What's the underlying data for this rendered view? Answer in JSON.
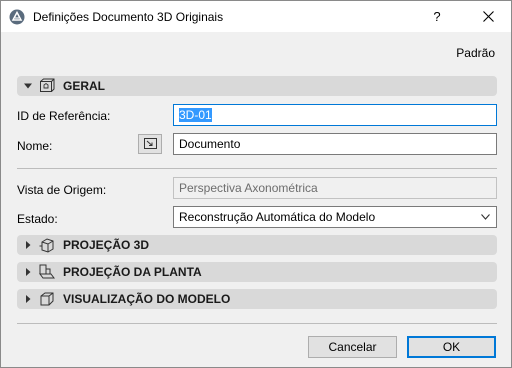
{
  "window": {
    "title": "Definições Documento 3D Originais",
    "help_label": "?"
  },
  "toolbar": {
    "defaults_label": "Padrão"
  },
  "general": {
    "title": "GERAL",
    "reference_id": {
      "label": "ID de Referência:",
      "value": "3D-01"
    },
    "name": {
      "label": "Nome:",
      "value": "Documento"
    },
    "source_view": {
      "label": "Vista de Origem:",
      "value": "Perspectiva Axonométrica"
    },
    "status": {
      "label": "Estado:",
      "value": "Reconstrução Automática do Modelo"
    }
  },
  "sections": [
    {
      "title": "PROJEÇÃO 3D",
      "icon": "cube-projection-icon"
    },
    {
      "title": "PROJEÇÃO DA PLANTA",
      "icon": "floor-plan-projection-icon"
    },
    {
      "title": "VISUALIZAÇÃO DO MODELO",
      "icon": "model-display-icon"
    }
  ],
  "buttons": {
    "cancel": "Cancelar",
    "ok": "OK"
  },
  "colors": {
    "accent": "#0078d7",
    "section_bg": "#d9d9d9",
    "selection": "#3399ff"
  }
}
